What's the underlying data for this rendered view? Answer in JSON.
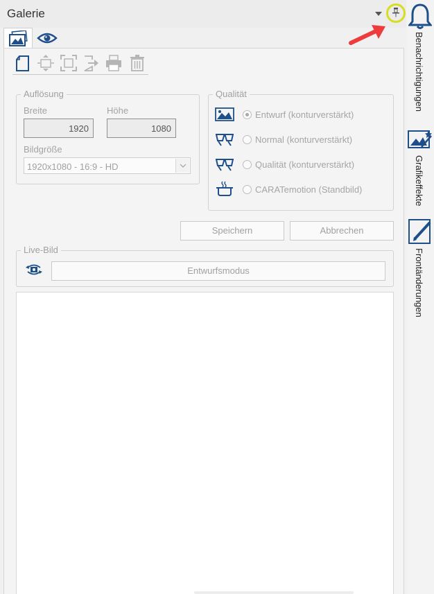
{
  "window": {
    "title": "Galerie"
  },
  "side_panel": {
    "tabs": [
      {
        "label": "Benachrichtigungen",
        "icon": "bell-icon"
      },
      {
        "label": "Grafikeffekte",
        "icon": "magic-wand-icon"
      },
      {
        "label": "Frontänderungen",
        "icon": "edit-pencil-icon"
      }
    ]
  },
  "tabs": [
    {
      "icon": "gallery-image-icon"
    },
    {
      "icon": "eye-icon"
    }
  ],
  "toolbar": [
    {
      "icon": "new-document-icon"
    },
    {
      "icon": "fit-height-icon"
    },
    {
      "icon": "fit-screen-icon"
    },
    {
      "icon": "export-icon"
    },
    {
      "icon": "print-icon"
    },
    {
      "icon": "trash-icon"
    }
  ],
  "resolution": {
    "legend": "Auflösung",
    "width_label": "Breite",
    "width_value": "1920",
    "height_label": "Höhe",
    "height_value": "1080",
    "size_label": "Bildgröße",
    "size_value": "1920x1080 - 16:9 - HD"
  },
  "quality": {
    "legend": "Qualität",
    "options": [
      {
        "label": "Entwurf (konturverstärkt)",
        "selected": true,
        "icon": "landscape-image-icon"
      },
      {
        "label": "Normal (konturverstärkt)",
        "selected": false,
        "icon": "glasses-icon"
      },
      {
        "label": "Qualität (konturverstärkt)",
        "selected": false,
        "icon": "glasses-icon"
      },
      {
        "label": "CARATemotion (Standbild)",
        "selected": false,
        "icon": "cooking-pot-icon"
      }
    ]
  },
  "actions": {
    "save": "Speichern",
    "cancel": "Abbrechen"
  },
  "live": {
    "legend": "Live-Bild",
    "mode_button": "Entwurfsmodus",
    "icon": "camera-rotate-icon"
  },
  "colors": {
    "accent": "#1e4f8a",
    "highlight_circle": "#d6de1f",
    "annotation_arrow": "#ee3b3b"
  }
}
